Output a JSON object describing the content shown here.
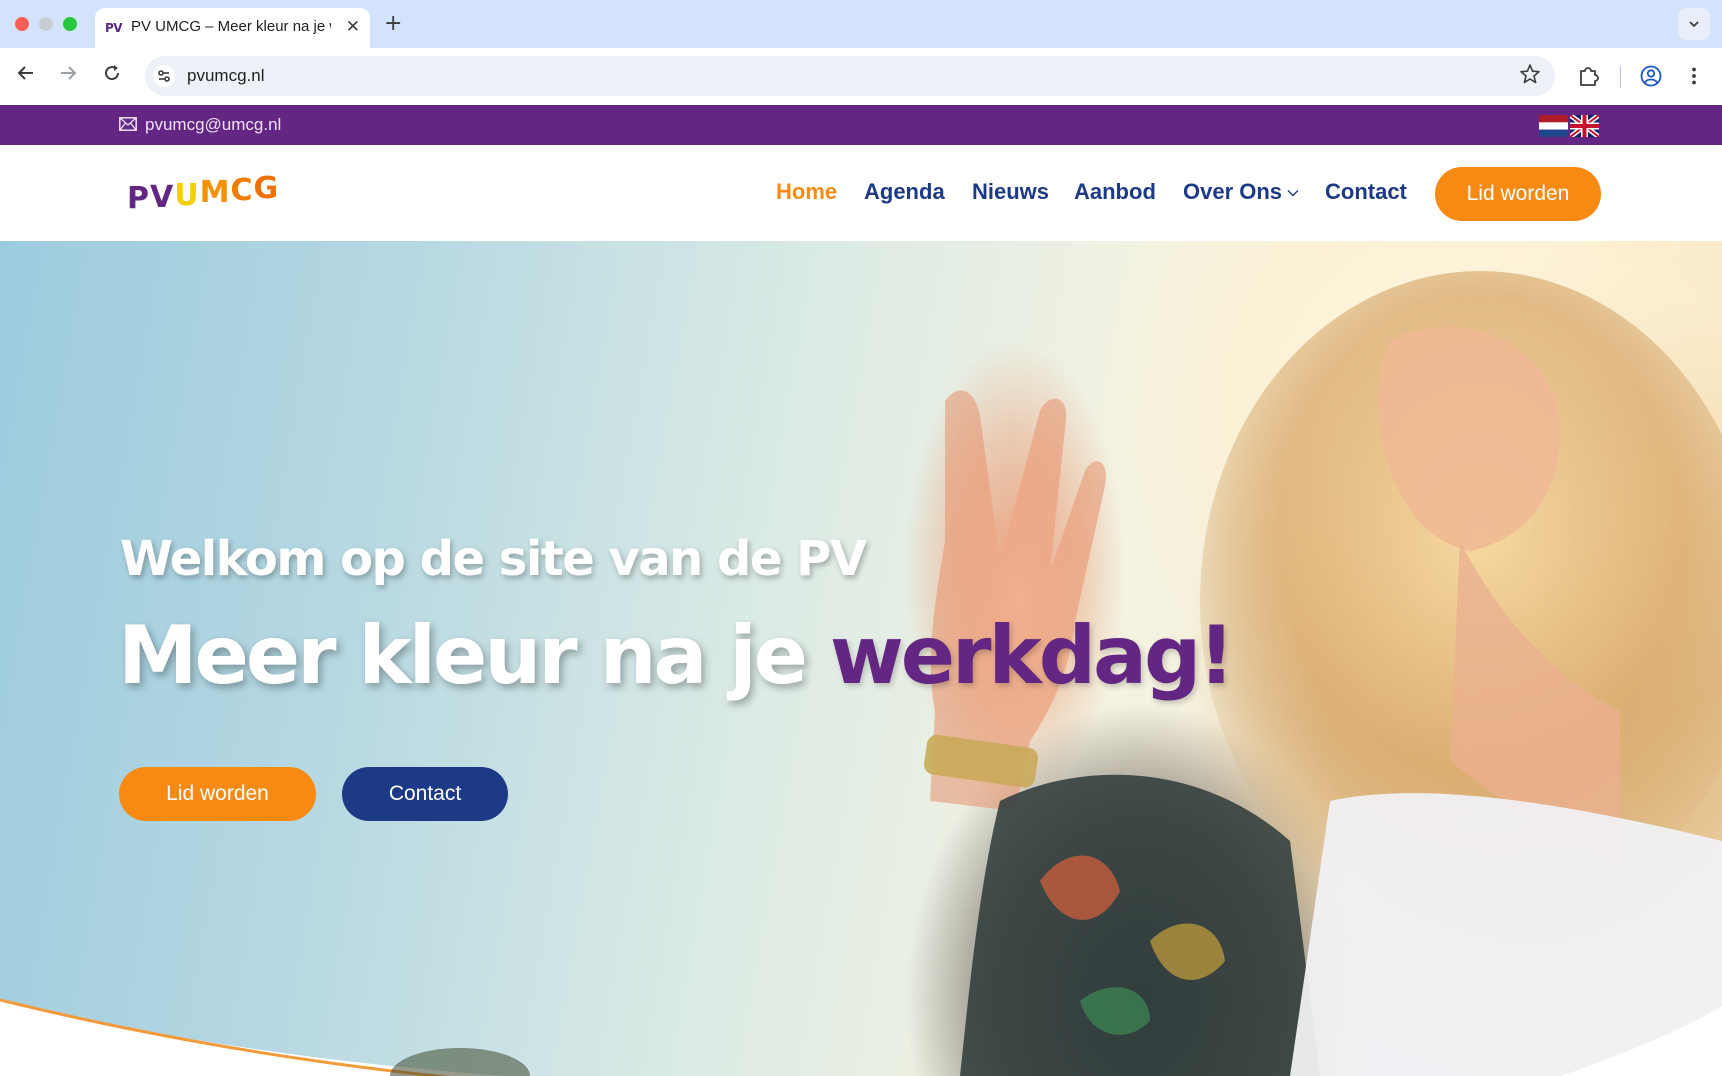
{
  "browser": {
    "tab": {
      "favicon_text": "PV",
      "title": "PV UMCG – Meer kleur na je werkdag!",
      "close_glyph": "✕"
    },
    "new_tab_glyph": "+",
    "address_bar": {
      "url": "pvumcg.nl"
    },
    "icons": {
      "back": "arrow-left-icon",
      "forward": "arrow-right-icon",
      "reload": "reload-icon",
      "site_info": "tune-icon",
      "bookmark": "star-icon",
      "extensions": "puzzle-icon",
      "profile": "account-circle-icon",
      "menu": "kebab-menu-icon",
      "tab_search": "chevron-down-icon"
    }
  },
  "topbar": {
    "email": "pvumcg@umcg.nl",
    "languages": [
      "nl-flag-icon",
      "uk-flag-icon"
    ],
    "background": "#642683"
  },
  "nav": {
    "logo": {
      "letters": [
        "P",
        "V",
        "U",
        "M",
        "C",
        "G"
      ]
    },
    "items": [
      {
        "label": "Home",
        "active": true
      },
      {
        "label": "Agenda"
      },
      {
        "label": "Nieuws"
      },
      {
        "label": "Aanbod"
      },
      {
        "label": "Over Ons",
        "has_dropdown": true
      },
      {
        "label": "Contact"
      }
    ],
    "cta_label": "Lid worden"
  },
  "hero": {
    "subtitle": "Welkom op de site van de PV",
    "title_prefix": "Meer kleur na je ",
    "title_accent": "werkdag!",
    "buttons": {
      "primary": "Lid worden",
      "secondary": "Contact"
    }
  },
  "colors": {
    "brand_purple": "#642683",
    "brand_orange": "#f78a12",
    "brand_navy": "#1d3a86",
    "logo_yellow": "#f5d000",
    "tab_strip": "#d3e3fd"
  }
}
